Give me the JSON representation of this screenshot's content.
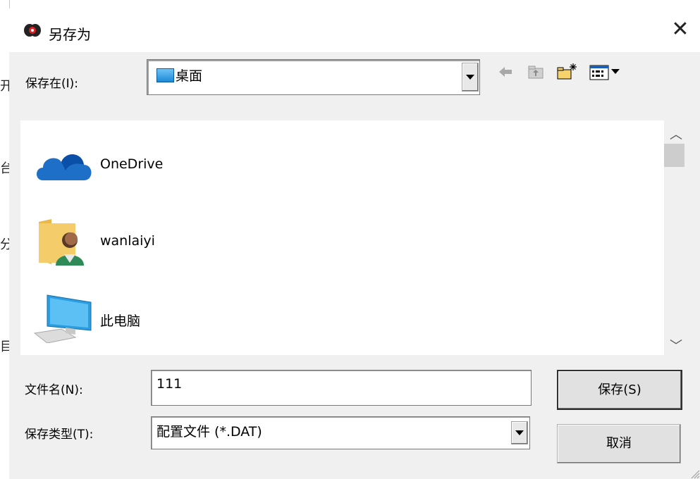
{
  "background_chars": [
    "开",
    "台",
    "分",
    "目"
  ],
  "dialog": {
    "title": "另存为",
    "close_label": "✕"
  },
  "save_in": {
    "label": "保存在(I):",
    "value": "桌面"
  },
  "toolbar": {
    "icons": [
      "back-arrow-icon",
      "up-folder-icon",
      "new-folder-icon",
      "view-menu-icon"
    ]
  },
  "file_list": {
    "items": [
      {
        "name": "OneDrive",
        "icon": "onedrive-cloud-icon"
      },
      {
        "name": "wanlaiyi",
        "icon": "user-folder-icon"
      },
      {
        "name": "此电脑",
        "icon": "computer-icon"
      }
    ]
  },
  "file_name": {
    "label": "文件名(N):",
    "value": "111"
  },
  "file_type": {
    "label": "保存类型(T):",
    "value": "配置文件 (*.DAT)"
  },
  "buttons": {
    "save": "保存(S)",
    "cancel": "取消"
  },
  "colors": {
    "dialog_bg": "#f0f0f0",
    "list_bg": "#ffffff",
    "onedrive_blue": "#1e6fc8"
  }
}
